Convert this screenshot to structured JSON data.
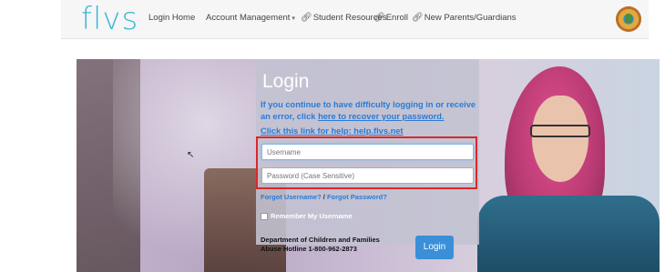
{
  "header": {
    "logo": "flvs",
    "nav": [
      {
        "label": "Login Home"
      },
      {
        "label": "Account Management",
        "caret": "▾"
      },
      {
        "label": "Student Resources",
        "icon": "link-icon"
      },
      {
        "label": "Enroll",
        "icon": "link-icon"
      },
      {
        "label": "New Parents/Guardians",
        "icon": "link-icon"
      }
    ],
    "seal": "florida-seal-icon"
  },
  "login": {
    "title": "Login",
    "help_prefix": "If you continue to have difficulty logging in or receive an error, click ",
    "help_link": "here to recover your password.",
    "help_site": "Click this link for help: help.flvs.net",
    "username_placeholder": "Username",
    "password_placeholder": "Password (Case Sensitive)",
    "forgot_username": "Forgot Username?",
    "forgot_separator": " / ",
    "forgot_password": "Forgot Password?",
    "remember_label": "Remember My Username",
    "hotline_line1": "Department of Children and Families",
    "hotline_line2": "Abuse Hotline 1-800-962-2873",
    "button_label": "Login"
  },
  "colors": {
    "accent": "#2a7bd6",
    "logo": "#3cb7d6",
    "highlight": "#d9282a"
  }
}
